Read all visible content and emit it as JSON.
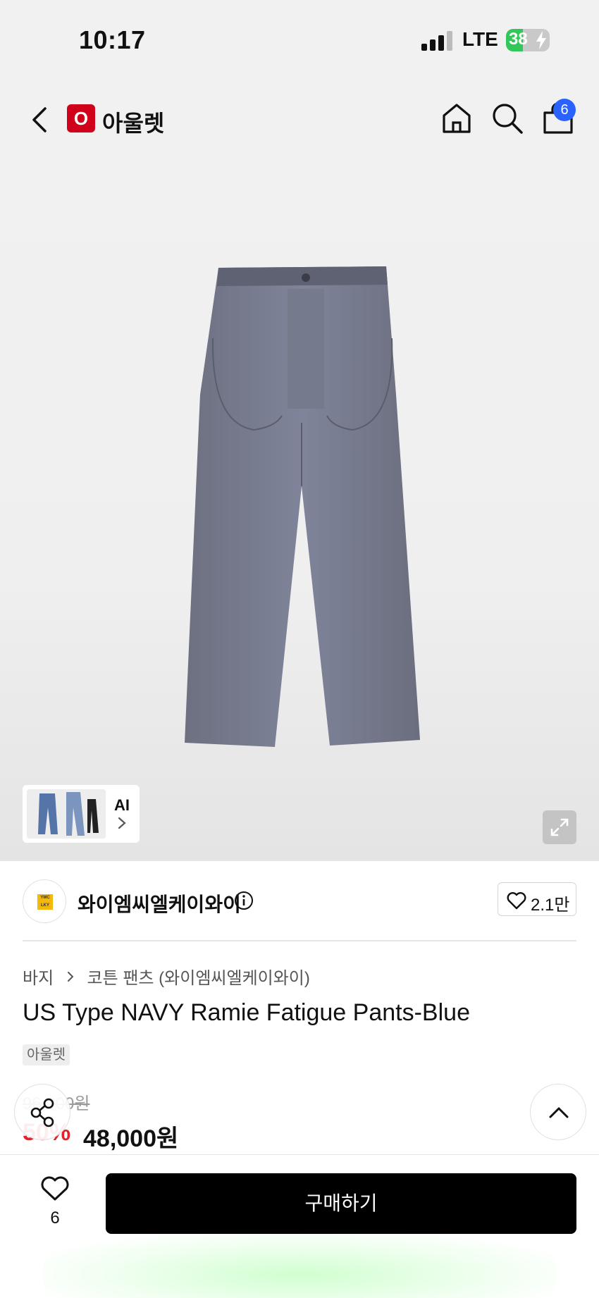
{
  "status": {
    "time": "10:17",
    "network": "LTE",
    "battery": "38",
    "battery_level": 0.38
  },
  "header": {
    "back_icon": "chevron-left-icon",
    "logo_letter": "O",
    "title": "아울렛",
    "home_icon": "home-icon",
    "search_icon": "search-icon",
    "cart_icon": "shopping-bag-icon",
    "cart_count": "6"
  },
  "image": {
    "thumb_label": "AI",
    "expand_icon": "expand-icon"
  },
  "seller": {
    "name": "와이엠씨엘케이와이",
    "logo_text": "YMC LKY",
    "like_count": "2.1만"
  },
  "product": {
    "breadcrumb": [
      "바지",
      "코튼 팬츠 (와이엠씨엘케이와이)"
    ],
    "title": "US Type NAVY Ramie Fatigue Pants-Blue",
    "tag": "아울렛",
    "original_price": "96,000원",
    "discount": "50%",
    "sale_price": "48,000원"
  },
  "bottom": {
    "wish_count": "6",
    "buy_label": "구매하기"
  },
  "colors": {
    "brand_red": "#d0021b",
    "badge_blue": "#2962ff",
    "discount_red": "#e8202a",
    "buy_button": "#000000",
    "battery_green": "#33c759"
  }
}
